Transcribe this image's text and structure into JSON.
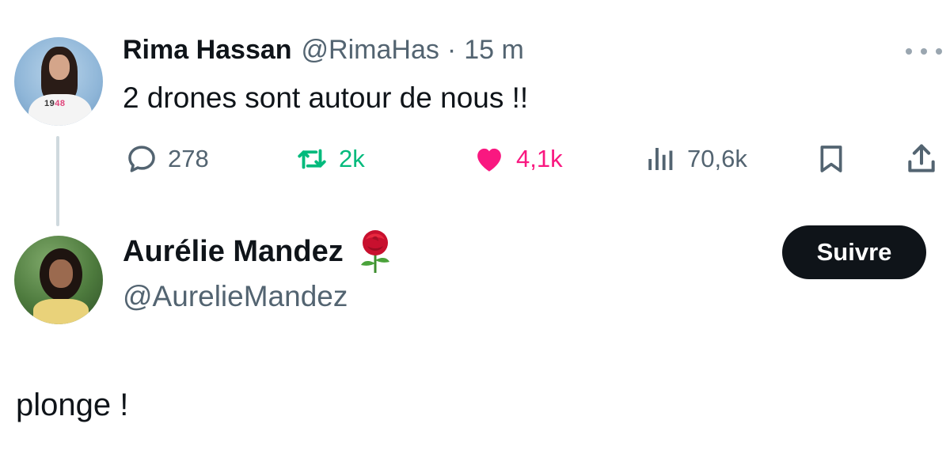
{
  "tweet1": {
    "author_name": "Rima Hassan",
    "handle": "@RimaHas",
    "separator": "·",
    "time": "15 m",
    "text": "2 drones sont autour de nous !!",
    "avatar_shirt_text_dark": "19",
    "avatar_shirt_text_pink": "48",
    "actions": {
      "replies": "278",
      "retweets": "2k",
      "likes": "4,1k",
      "views": "70,6k"
    }
  },
  "tweet2": {
    "author_name": "Aurélie Mandez",
    "name_emoji": "rose-icon",
    "handle": "@AurelieMandez",
    "follow_label": "Suivre",
    "text": "plonge !"
  },
  "colors": {
    "text": "#0f1419",
    "secondary": "#536471",
    "retweet": "#00ba7c",
    "like": "#f91880",
    "follow_bg": "#0f1419",
    "thread_line": "#cfd9de"
  }
}
